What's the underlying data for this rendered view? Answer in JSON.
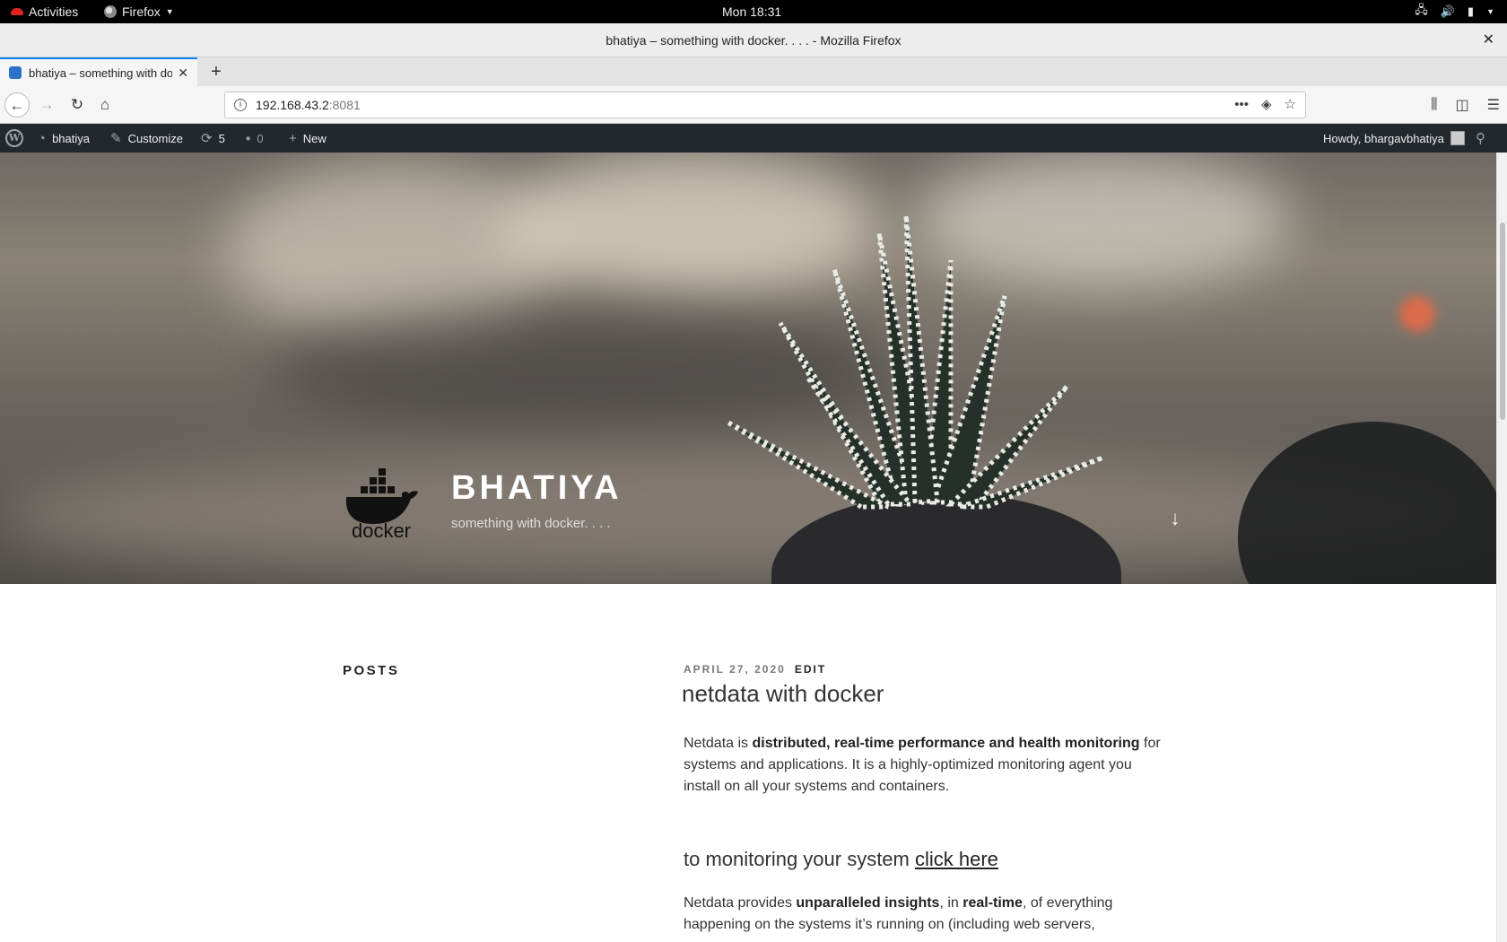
{
  "system_bar": {
    "activities": "Activities",
    "app_menu": "Firefox",
    "clock": "Mon 18:31"
  },
  "window": {
    "title": "bhatiya – something with docker. . . . - Mozilla Firefox"
  },
  "tabs": [
    {
      "label": "bhatiya – something with docker"
    }
  ],
  "urlbar": {
    "host": "192.168.43.2",
    "port": ":8081"
  },
  "adminbar": {
    "site_name": "bhatiya",
    "customize": "Customize",
    "updates_count": "5",
    "comments_count": "0",
    "new": "New",
    "howdy": "Howdy, bhargavbhatiya"
  },
  "header": {
    "logo_text": "docker",
    "site_title": "BHATIYA",
    "site_description": "something with docker. . . ."
  },
  "sidebar": {
    "posts_heading": "POSTS"
  },
  "post": {
    "date": "APRIL 27, 2020",
    "edit": "EDIT",
    "title": "netdata with docker",
    "p1_pre": "Netdata is ",
    "p1_bold": "distributed, real-time performance and health monitoring",
    "p1_post": " for systems and applications. It is a highly-optimized monitoring agent you install on all your systems and containers.",
    "h3_pre": "to monitoring your system ",
    "h3_link": "click here",
    "p2_a": "Netdata provides ",
    "p2_b": "unparalleled insights",
    "p2_c": ", in ",
    "p2_d": "real-time",
    "p2_e": ", of everything happening on the systems it’s running on (including web servers,"
  }
}
